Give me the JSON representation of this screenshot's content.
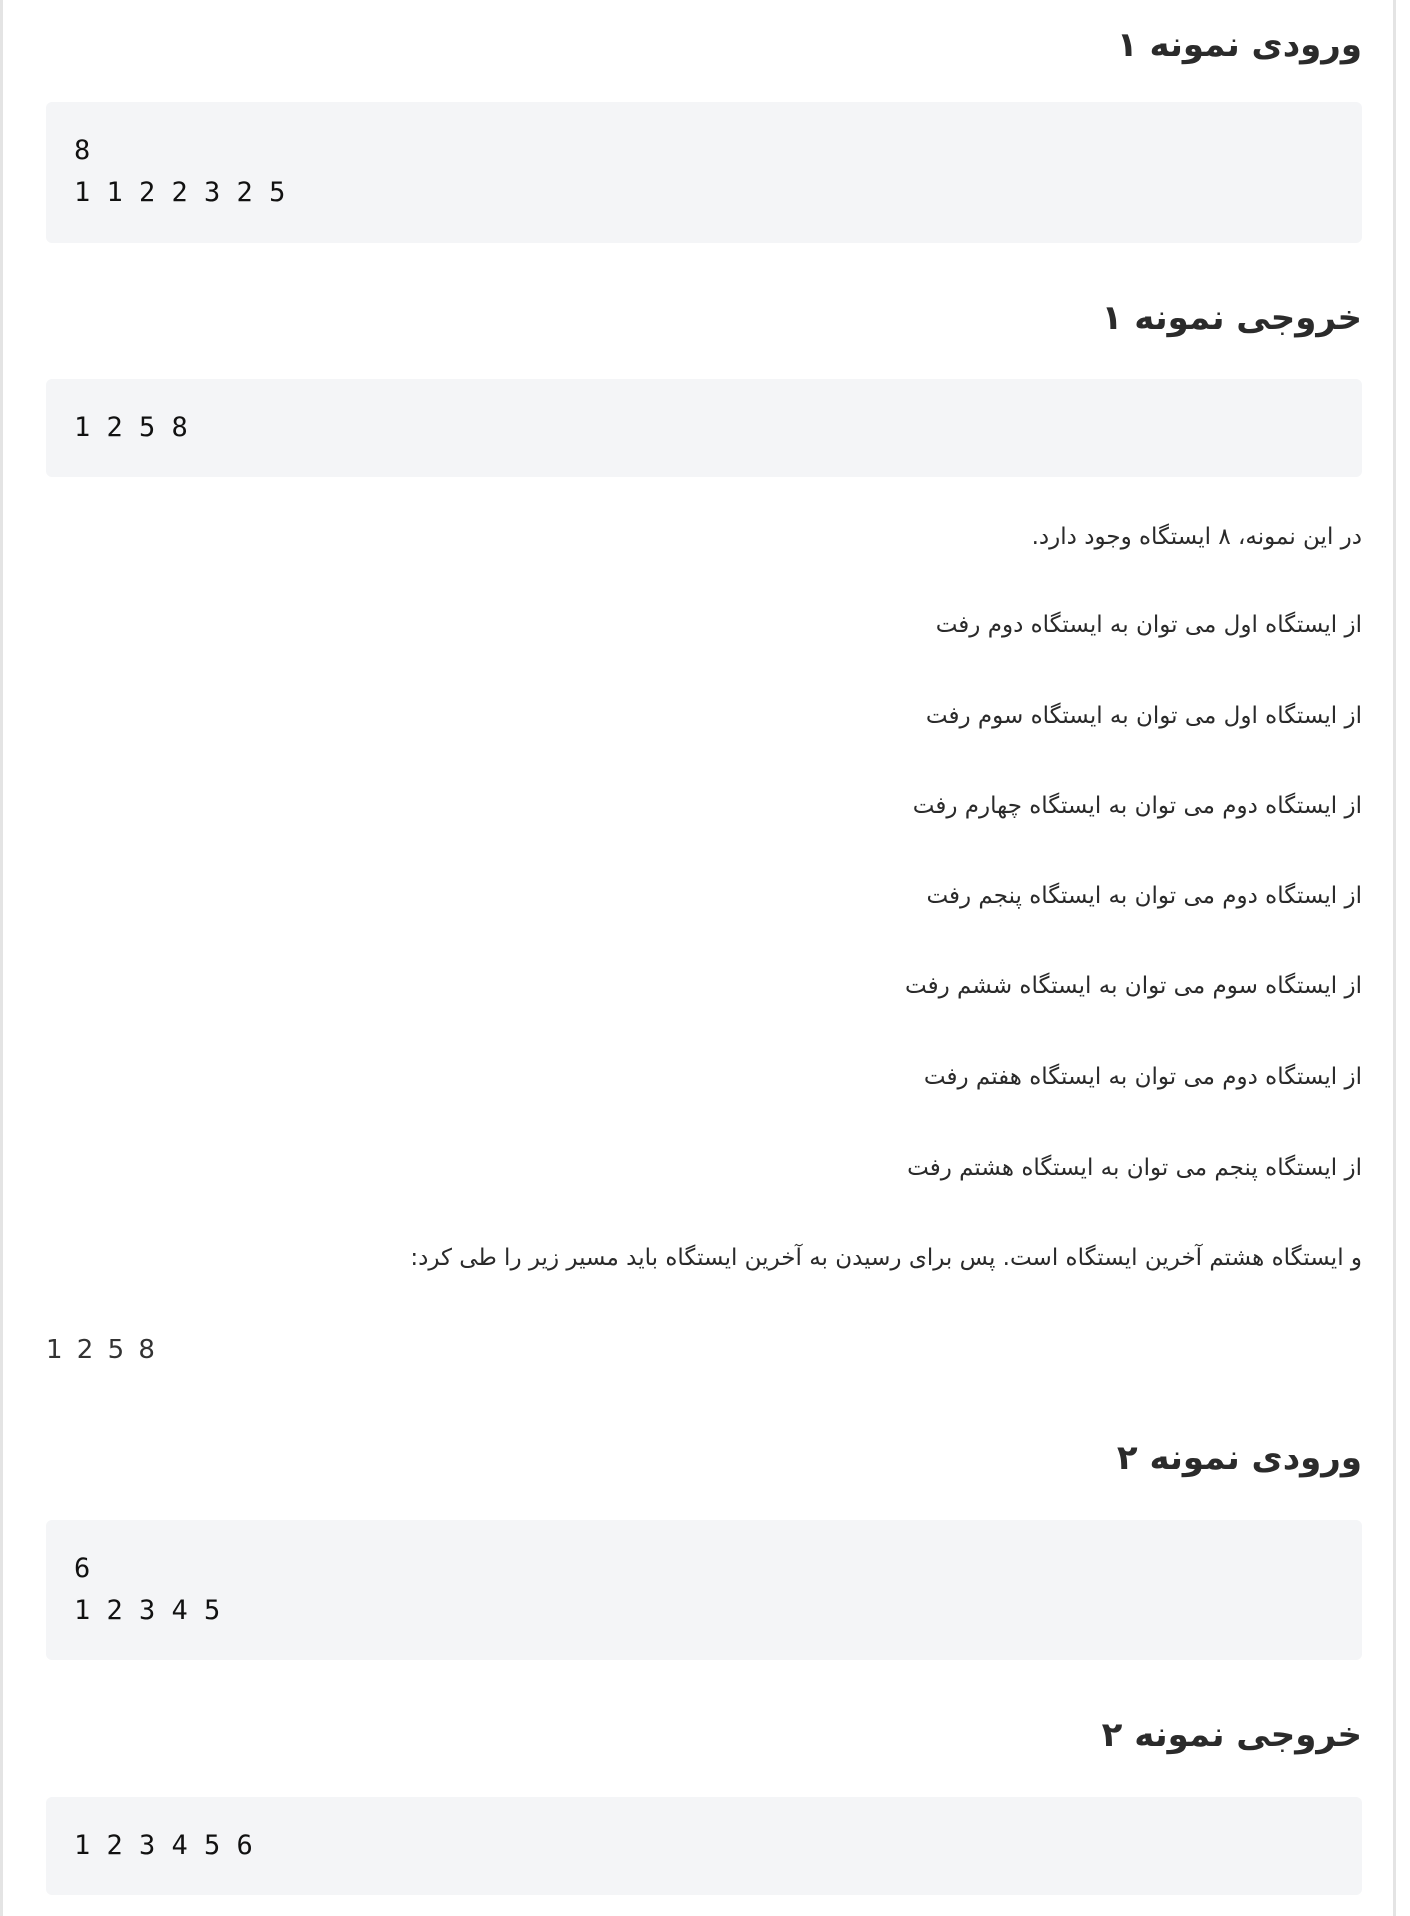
{
  "sample1": {
    "input_heading": "ورودی نمونه ۱",
    "input_lines": [
      "8",
      "1 1 2 2 3 2 5"
    ],
    "output_heading": "خروجی نمونه ۱",
    "output_lines": [
      "1 2 5 8"
    ]
  },
  "explanation": {
    "paragraphs": [
      "در این نمونه، ۸ ایستگاه وجود دارد.",
      "از ایستگاه اول می توان به ایستگاه دوم رفت",
      "از ایستگاه اول می توان به ایستگاه سوم رفت",
      "از ایستگاه دوم می توان به ایستگاه چهارم رفت",
      "از ایستگاه دوم می توان به ایستگاه پنجم رفت",
      "از ایستگاه سوم می توان به ایستگاه ششم رفت",
      "از ایستگاه دوم می توان به ایستگاه هفتم رفت",
      "از ایستگاه پنجم می توان به ایستگاه هشتم رفت",
      "و ایستگاه هشتم آخرین ایستگاه است. پس برای رسیدن به آخرین ایستگاه باید مسیر زیر را طی کرد:"
    ],
    "path": "1 2 5 8"
  },
  "sample2": {
    "input_heading": "ورودی نمونه ۲",
    "input_lines": [
      "6",
      "1 2 3 4 5"
    ],
    "output_heading": "خروجی نمونه ۲",
    "output_lines": [
      "1 2 3 4 5 6"
    ]
  }
}
